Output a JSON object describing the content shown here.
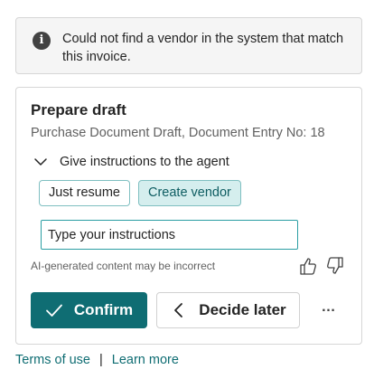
{
  "banner": {
    "icon": "info-icon",
    "icon_glyph": "i",
    "message": "Could not find a vendor in the system that match this invoice."
  },
  "card": {
    "title": "Prepare draft",
    "subtitle": "Purchase Document Draft, Document Entry No: 18",
    "instructions_toggle": "Give instructions to the agent",
    "suggestions": [
      "Just resume",
      "Create vendor"
    ],
    "input_placeholder": "Type your instructions",
    "disclaimer": "AI-generated content may be incorrect",
    "confirm_label": "Confirm",
    "decide_later_label": "Decide later",
    "more_label": "…"
  },
  "footer": {
    "terms_label": "Terms of use",
    "separator": "|",
    "learn_more_label": "Learn more"
  },
  "colors": {
    "accent": "#0f6d73",
    "chip_selected_bg": "#d5eeee",
    "chip_border": "#7fbfc1",
    "banner_bg": "#f5f5f5"
  }
}
